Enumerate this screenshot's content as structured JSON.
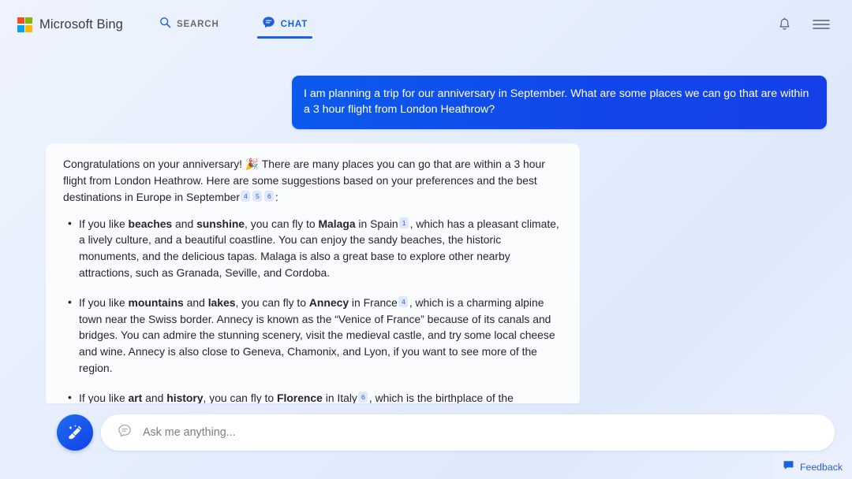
{
  "header": {
    "brand": "Microsoft Bing",
    "logo_icon": "microsoft-squares-icon",
    "tabs": [
      {
        "label": "SEARCH",
        "icon": "search-icon",
        "active": false
      },
      {
        "label": "CHAT",
        "icon": "chat-bubble-icon",
        "active": true
      }
    ],
    "notifications_icon": "bell-icon",
    "menu_icon": "hamburger-menu-icon"
  },
  "conversation": {
    "user_message": "I am planning a trip for our anniversary in September. What are some places we can go that are within a 3 hour flight from London Heathrow?",
    "bot_intro_part1": "Congratulations on your anniversary! ",
    "bot_intro_emoji": "🎉",
    "bot_intro_part2": " There are many places you can go that are within a 3 hour flight from London Heathrow. Here are some suggestions based on your preferences and the best destinations in Europe in September",
    "bot_intro_citations": [
      "4",
      "5",
      "6"
    ],
    "bot_intro_colon": ":",
    "items": [
      {
        "lead": "If you like ",
        "bold1": "beaches",
        "mid1": " and ",
        "bold2": "sunshine",
        "mid2": ", you can fly to ",
        "bold3": "Malaga",
        "mid3": " in Spain",
        "citation": "1",
        "tail": ", which has a pleasant climate, a lively culture, and a beautiful coastline. You can enjoy the sandy beaches, the historic monuments, and the delicious tapas. Malaga is also a great base to explore other nearby attractions, such as Granada, Seville, and Cordoba."
      },
      {
        "lead": "If you like ",
        "bold1": "mountains",
        "mid1": " and ",
        "bold2": "lakes",
        "mid2": ", you can fly to ",
        "bold3": "Annecy",
        "mid3": " in France",
        "citation": "4",
        "tail": ", which is a charming alpine town near the Swiss border. Annecy is known as the “Venice of France” because of its canals and bridges. You can admire the stunning scenery, visit the medieval castle, and try some local cheese and wine. Annecy is also close to Geneva, Chamonix, and Lyon, if you want to see more of the region."
      },
      {
        "lead": "If you like ",
        "bold1": "art",
        "mid1": " and ",
        "bold2": "history",
        "mid2": ", you can fly to ",
        "bold3": "Florence",
        "mid3": " in Italy",
        "citation": "6",
        "tail": ", which is the birthplace of the Renaissance and a UNESCO World Heritage Site. Florence is a treasure trove of artistic and architectural masterpieces, such as the Duomo, the Uffizi Gallery, and the Ponte Vecchio. You can also explore the Tuscan countryside, taste the famous gelato, and shop for leather goods."
      }
    ]
  },
  "composer": {
    "new_topic_icon": "broom-sweep-icon",
    "input_icon": "chat-bubble-outline-icon",
    "placeholder": "Ask me anything...",
    "value": ""
  },
  "feedback": {
    "label": "Feedback",
    "icon": "feedback-chat-icon"
  },
  "colors": {
    "accent_blue": "#1b5fe3",
    "user_bubble_blue": "#1147ea",
    "citation_bg": "#dfe8fd",
    "citation_text": "#2b5fd9",
    "page_bg": "#e6eefc"
  }
}
